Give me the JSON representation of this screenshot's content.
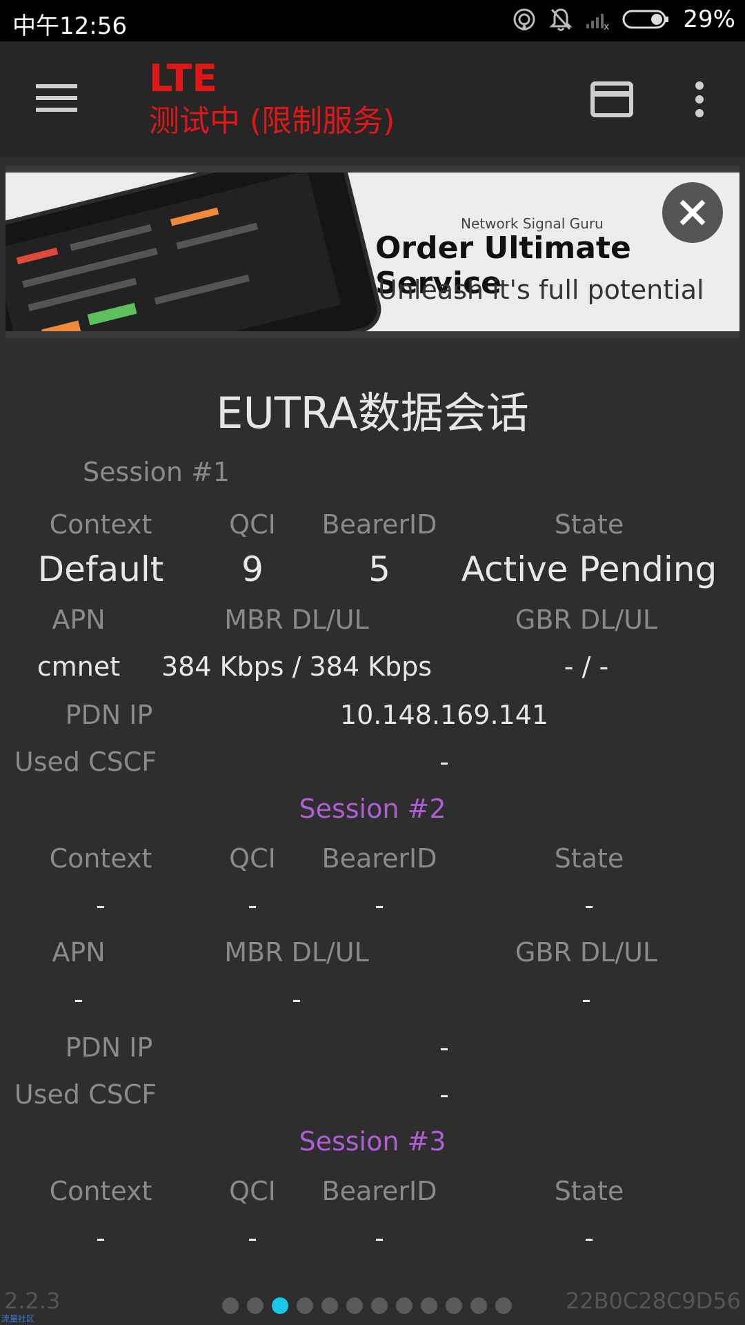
{
  "status_bar": {
    "time": "中午12:56",
    "battery": "29%",
    "icons": [
      "hotspot-icon",
      "bell-off-icon",
      "signal-icon",
      "battery-icon"
    ]
  },
  "app_bar": {
    "title": "LTE",
    "subtitle": "测试中 (限制服务)",
    "title_color": "#e01717"
  },
  "ad": {
    "brand": "Network Signal Guru",
    "headline": "Order Ultimate Service",
    "tagline": "Unleash it's full potential"
  },
  "section_title": "EUTRA数据会话",
  "labels": {
    "context": "Context",
    "qci": "QCI",
    "bearer_id": "BearerID",
    "state": "State",
    "apn": "APN",
    "mbr": "MBR DL/UL",
    "gbr": "GBR DL/UL",
    "pdn_ip": "PDN IP",
    "used_cscf": "Used CSCF"
  },
  "sessions": [
    {
      "name": "Session #1",
      "context": "Default",
      "qci": "9",
      "bearer_id": "5",
      "state": "Active Pending",
      "apn": "cmnet",
      "mbr": "384 Kbps / 384 Kbps",
      "gbr": "- / -",
      "pdn_ip": "10.148.169.141",
      "used_cscf": "-"
    },
    {
      "name": "Session #2",
      "context": "-",
      "qci": "-",
      "bearer_id": "-",
      "state": "-",
      "apn": "-",
      "mbr": "-",
      "gbr": "-",
      "pdn_ip": "-",
      "used_cscf": "-"
    },
    {
      "name": "Session #3",
      "context": "-",
      "qci": "-",
      "bearer_id": "-",
      "state": "-"
    }
  ],
  "footer": {
    "version": "2.2.3",
    "device_id": "22B0C28C9D56",
    "forum": "流量社区",
    "page_count": 12,
    "active_page": 3
  },
  "colors": {
    "accent": "#b05ed6",
    "active_dot": "#19c8e8"
  }
}
